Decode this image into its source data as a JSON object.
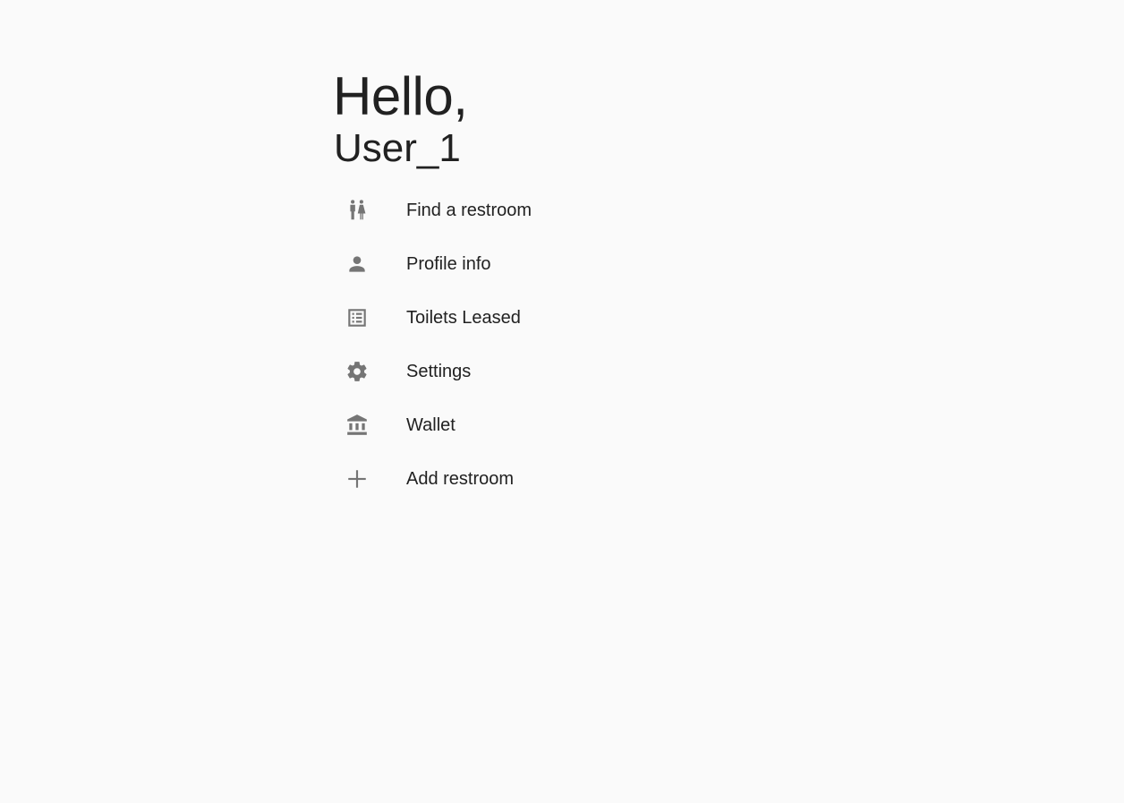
{
  "greeting": {
    "hello": "Hello,",
    "user": "User_1"
  },
  "menu": {
    "items": [
      {
        "icon": "restroom-icon",
        "label": "Find a restroom"
      },
      {
        "icon": "person-icon",
        "label": "Profile info"
      },
      {
        "icon": "list-icon",
        "label": "Toilets Leased"
      },
      {
        "icon": "gear-icon",
        "label": "Settings"
      },
      {
        "icon": "bank-icon",
        "label": "Wallet"
      },
      {
        "icon": "plus-icon",
        "label": "Add restroom"
      }
    ]
  },
  "colors": {
    "background": "#fafafa",
    "text": "#212121",
    "icon": "#757575"
  }
}
